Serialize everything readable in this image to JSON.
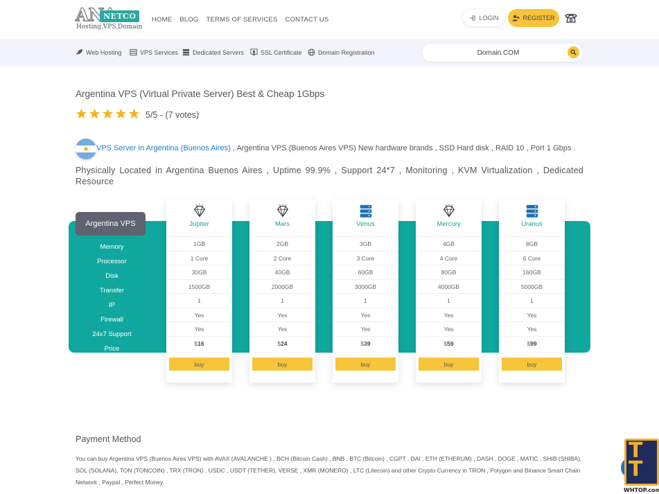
{
  "header": {
    "logo_big": "ANA",
    "logo_tag": "NETCO",
    "logo_sub": "Hosting,VPS,Domain",
    "nav": [
      "HOME",
      "BLOG",
      "TERMS OF SERVICES",
      "CONTACT US"
    ],
    "login_label": "LOGIN",
    "register_label": "REGISTER"
  },
  "subnav": {
    "items": [
      "Web Hosting",
      "VPS Services",
      "Dedicated Servers",
      "SSL Certificate",
      "Domain Registration"
    ],
    "search_placeholder": "Domain.COM"
  },
  "content": {
    "title": "Argentina VPS (Virtual Private Server) Best & Cheap 1Gbps",
    "rating": 5,
    "rating_text": "5/5 - (7 votes)",
    "intro_link": "VPS Server in Argentina (Buenos Aires)",
    "intro_rest": " , Argentina VPS (Buenos Aires VPS) New hardware brands , SSD Hard disk , RAID 10 , Port 1 Gbps .",
    "description": "Physically Located in Argentina Buenos Aires , Uptime 99.9% , Support 24*7 , Monitoring , KVM Virtualization , Dedicated Resource"
  },
  "pricing": {
    "heading": "Argentina VPS",
    "features": [
      "Memory",
      "Processor",
      "Disk",
      "Transfer",
      "IP",
      "Firewall",
      "24x7 Support",
      "Price"
    ],
    "currency": "$",
    "buy_label": "buy",
    "plans": [
      {
        "name": "Jupiter",
        "icon": "diamond-icon",
        "memory": "1GB",
        "processor": "1 Core",
        "disk": "30GB",
        "transfer": "1500GB",
        "ip": "1",
        "firewall": "Yes",
        "support": "Yes",
        "price": "16"
      },
      {
        "name": "Mars",
        "icon": "diamond-icon",
        "memory": "2GB",
        "processor": "2 Core",
        "disk": "40GB",
        "transfer": "2000GB",
        "ip": "1",
        "firewall": "Yes",
        "support": "Yes",
        "price": "24"
      },
      {
        "name": "Venus",
        "icon": "server-icon",
        "memory": "3GB",
        "processor": "3 Core",
        "disk": "60GB",
        "transfer": "3000GB",
        "ip": "1",
        "firewall": "Yes",
        "support": "Yes",
        "price": "39"
      },
      {
        "name": "Mercury",
        "icon": "diamond-icon",
        "memory": "4GB",
        "processor": "4 Core",
        "disk": "80GB",
        "transfer": "4000GB",
        "ip": "1",
        "firewall": "Yes",
        "support": "Yes",
        "price": "59"
      },
      {
        "name": "Uranus",
        "icon": "server-icon",
        "memory": "8GB",
        "processor": "6 Core",
        "disk": "160GB",
        "transfer": "5000GB",
        "ip": "1",
        "firewall": "Yes",
        "support": "Yes",
        "price": "99"
      }
    ]
  },
  "payment": {
    "title": "Payment Method",
    "text": "You can buy Argentina VPS (Buenos Aires VPS) with  AVAX (AVALANCHE ) , BCH (Bitcoin Cash) , BNB , BTC (Bitcoin) , CGPT , DAI , ETH (ETHERUM) , DASH , DOGE , MATIC , SHIB (SHIBA), SOL (SOLANA), TON (TONCOIN) , TRX (TRON) , USDC , USDT (TETHER), VERSE  , XMR (MONERO) , LTC (Litecoin) and other Crypto Currency in TRON , Polygon  and Binance Smart Chain Network , Paypal , Perfect Money."
  },
  "watermark": {
    "letters": "TT",
    "label": "WHTOP.com"
  },
  "colors": {
    "accent_yellow": "#f7c43a",
    "teal": "#10a89e",
    "link_blue": "#1a7fd4",
    "star": "#f4b41a"
  }
}
